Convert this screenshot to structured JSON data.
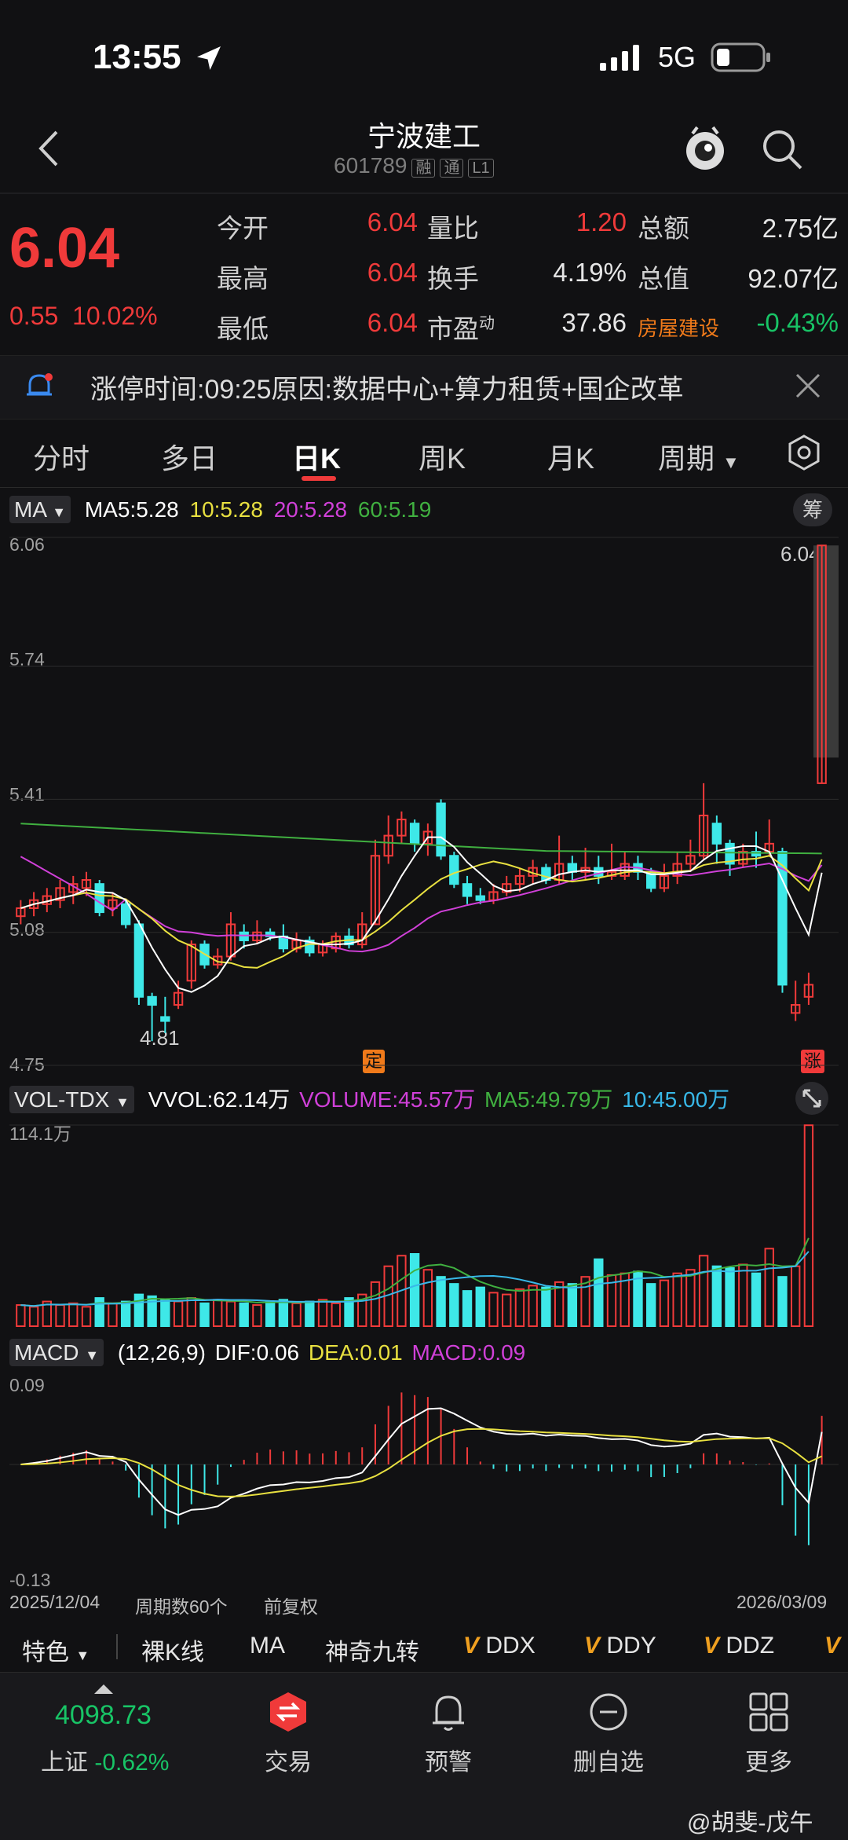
{
  "status": {
    "time": "13:55",
    "network": "5G"
  },
  "header": {
    "title": "宁波建工",
    "code": "601789",
    "tags": [
      "融",
      "通",
      "L1"
    ]
  },
  "quote": {
    "price": "6.04",
    "change": "0.55",
    "change_pct": "10.02%",
    "fields": [
      {
        "label": "今开",
        "value": "6.04"
      },
      {
        "label": "最高",
        "value": "6.04"
      },
      {
        "label": "最低",
        "value": "6.04"
      },
      {
        "label": "量比",
        "value": "1.20"
      },
      {
        "label": "换手",
        "value": "4.19%"
      },
      {
        "label": "市盈",
        "sup": "动",
        "value": "37.86"
      },
      {
        "label": "总额",
        "value": "2.75亿"
      },
      {
        "label": "总值",
        "value": "92.07亿"
      },
      {
        "label": "房屋建设",
        "value": "-0.43%"
      }
    ]
  },
  "notice": {
    "text": "涨停时间:09:25原因:数据中心+算力租赁+国企改革"
  },
  "tabs": [
    "分时",
    "多日",
    "日K",
    "周K",
    "月K",
    "周期"
  ],
  "ma_header": {
    "label": "MA",
    "ma5": "MA5:5.28",
    "ma10": "10:5.28",
    "ma20": "20:5.28",
    "ma60": "60:5.19",
    "chip": "筹"
  },
  "vol_header": {
    "label": "VOL-TDX",
    "vvol": "VVOL:62.14万",
    "volume": "VOLUME:45.57万",
    "ma5": "MA5:49.79万",
    "ma10": "10:45.00万"
  },
  "macd_header": {
    "label": "MACD",
    "params": "(12,26,9)",
    "dif": "DIF:0.06",
    "dea": "DEA:0.01",
    "macd": "MACD:0.09"
  },
  "price_axis": {
    "top": "6.06",
    "l2": "5.74",
    "l3": "5.41",
    "l4": "5.08",
    "bottom": "4.75",
    "last": "6.04",
    "low_mark": "4.81",
    "mark_ding": "定",
    "mark_zhang": "涨"
  },
  "vol_axis": {
    "top": "114.1万"
  },
  "macd_axis": {
    "top": "0.09",
    "bottom": "-0.13"
  },
  "x_axis": {
    "start": "2025/12/04",
    "count": "周期数60个",
    "adjust": "前复权",
    "end": "2026/03/09"
  },
  "toolbar": [
    "特色",
    "裸K线",
    "MA",
    "神奇九转",
    "DDX",
    "DDY",
    "DDZ"
  ],
  "bottom_nav": {
    "index_value": "4098.73",
    "index_name": "上证",
    "index_change": "-0.62%",
    "items": [
      "交易",
      "预警",
      "删自选",
      "更多"
    ]
  },
  "watermark": "@胡斐-戊午",
  "colors": {
    "up": "#f03a3a",
    "down": "#3ee8e8",
    "ma5": "#ffffff",
    "ma10": "#e8e040",
    "ma20": "#d040d8",
    "ma60": "#40b040"
  },
  "chart_data": {
    "type": "candlestick",
    "candles": [
      {
        "o": 5.12,
        "c": 5.14,
        "h": 5.16,
        "l": 5.1
      },
      {
        "o": 5.14,
        "c": 5.16,
        "h": 5.18,
        "l": 5.12
      },
      {
        "o": 5.15,
        "c": 5.17,
        "h": 5.19,
        "l": 5.13
      },
      {
        "o": 5.16,
        "c": 5.19,
        "h": 5.21,
        "l": 5.14
      },
      {
        "o": 5.18,
        "c": 5.2,
        "h": 5.22,
        "l": 5.15
      },
      {
        "o": 5.19,
        "c": 5.21,
        "h": 5.23,
        "l": 5.17
      },
      {
        "o": 5.2,
        "c": 5.13,
        "h": 5.21,
        "l": 5.12
      },
      {
        "o": 5.14,
        "c": 5.16,
        "h": 5.18,
        "l": 5.12
      },
      {
        "o": 5.15,
        "c": 5.1,
        "h": 5.16,
        "l": 5.09
      },
      {
        "o": 5.1,
        "c": 4.92,
        "h": 5.11,
        "l": 4.9
      },
      {
        "o": 4.92,
        "c": 4.9,
        "h": 4.93,
        "l": 4.81
      },
      {
        "o": 4.87,
        "c": 4.86,
        "h": 4.92,
        "l": 4.83
      },
      {
        "o": 4.9,
        "c": 4.93,
        "h": 4.96,
        "l": 4.89
      },
      {
        "o": 4.96,
        "c": 5.05,
        "h": 5.06,
        "l": 4.94
      },
      {
        "o": 5.05,
        "c": 5.0,
        "h": 5.06,
        "l": 4.99
      },
      {
        "o": 5.0,
        "c": 5.02,
        "h": 5.04,
        "l": 4.99
      },
      {
        "o": 5.02,
        "c": 5.1,
        "h": 5.13,
        "l": 5.01
      },
      {
        "o": 5.08,
        "c": 5.06,
        "h": 5.1,
        "l": 5.04
      },
      {
        "o": 5.06,
        "c": 5.08,
        "h": 5.11,
        "l": 5.05
      },
      {
        "o": 5.08,
        "c": 5.07,
        "h": 5.09,
        "l": 5.06
      },
      {
        "o": 5.07,
        "c": 5.04,
        "h": 5.1,
        "l": 5.03
      },
      {
        "o": 5.04,
        "c": 5.06,
        "h": 5.08,
        "l": 5.03
      },
      {
        "o": 5.06,
        "c": 5.03,
        "h": 5.07,
        "l": 5.02
      },
      {
        "o": 5.03,
        "c": 5.05,
        "h": 5.06,
        "l": 5.02
      },
      {
        "o": 5.04,
        "c": 5.07,
        "h": 5.08,
        "l": 5.03
      },
      {
        "o": 5.07,
        "c": 5.05,
        "h": 5.09,
        "l": 5.04
      },
      {
        "o": 5.05,
        "c": 5.1,
        "h": 5.13,
        "l": 5.04
      },
      {
        "o": 5.1,
        "c": 5.27,
        "h": 5.31,
        "l": 5.1
      },
      {
        "o": 5.27,
        "c": 5.32,
        "h": 5.37,
        "l": 5.25
      },
      {
        "o": 5.32,
        "c": 5.36,
        "h": 5.38,
        "l": 5.3
      },
      {
        "o": 5.35,
        "c": 5.3,
        "h": 5.36,
        "l": 5.28
      },
      {
        "o": 5.3,
        "c": 5.33,
        "h": 5.35,
        "l": 5.27
      },
      {
        "o": 5.4,
        "c": 5.27,
        "h": 5.41,
        "l": 5.26
      },
      {
        "o": 5.27,
        "c": 5.2,
        "h": 5.28,
        "l": 5.19
      },
      {
        "o": 5.2,
        "c": 5.17,
        "h": 5.22,
        "l": 5.15
      },
      {
        "o": 5.17,
        "c": 5.16,
        "h": 5.19,
        "l": 5.15
      },
      {
        "o": 5.16,
        "c": 5.18,
        "h": 5.2,
        "l": 5.15
      },
      {
        "o": 5.18,
        "c": 5.2,
        "h": 5.22,
        "l": 5.17
      },
      {
        "o": 5.2,
        "c": 5.22,
        "h": 5.24,
        "l": 5.18
      },
      {
        "o": 5.22,
        "c": 5.24,
        "h": 5.26,
        "l": 5.2
      },
      {
        "o": 5.24,
        "c": 5.21,
        "h": 5.25,
        "l": 5.2
      },
      {
        "o": 5.21,
        "c": 5.25,
        "h": 5.32,
        "l": 5.2
      },
      {
        "o": 5.25,
        "c": 5.23,
        "h": 5.27,
        "l": 5.21
      },
      {
        "o": 5.23,
        "c": 5.24,
        "h": 5.29,
        "l": 5.21
      },
      {
        "o": 5.24,
        "c": 5.22,
        "h": 5.27,
        "l": 5.2
      },
      {
        "o": 5.22,
        "c": 5.23,
        "h": 5.3,
        "l": 5.21
      },
      {
        "o": 5.22,
        "c": 5.25,
        "h": 5.28,
        "l": 5.21
      },
      {
        "o": 5.25,
        "c": 5.23,
        "h": 5.27,
        "l": 5.21
      },
      {
        "o": 5.23,
        "c": 5.19,
        "h": 5.24,
        "l": 5.18
      },
      {
        "o": 5.19,
        "c": 5.22,
        "h": 5.25,
        "l": 5.18
      },
      {
        "o": 5.22,
        "c": 5.25,
        "h": 5.28,
        "l": 5.2
      },
      {
        "o": 5.25,
        "c": 5.27,
        "h": 5.31,
        "l": 5.23
      },
      {
        "o": 5.27,
        "c": 5.37,
        "h": 5.45,
        "l": 5.26
      },
      {
        "o": 5.35,
        "c": 5.3,
        "h": 5.37,
        "l": 5.25
      },
      {
        "o": 5.3,
        "c": 5.25,
        "h": 5.31,
        "l": 5.22
      },
      {
        "o": 5.25,
        "c": 5.28,
        "h": 5.3,
        "l": 5.24
      },
      {
        "o": 5.28,
        "c": 5.27,
        "h": 5.33,
        "l": 5.24
      },
      {
        "o": 5.28,
        "c": 5.3,
        "h": 5.36,
        "l": 5.27
      },
      {
        "o": 5.28,
        "c": 4.95,
        "h": 5.29,
        "l": 4.93
      },
      {
        "o": 4.88,
        "c": 4.9,
        "h": 4.96,
        "l": 4.86
      },
      {
        "o": 4.92,
        "c": 4.95,
        "h": 4.98,
        "l": 4.9
      },
      {
        "o": 5.45,
        "c": 6.04,
        "h": 6.04,
        "l": 5.45
      }
    ],
    "ylim": [
      4.75,
      6.06
    ],
    "volume": [
      12,
      11,
      14,
      12,
      13,
      11,
      16,
      13,
      14,
      18,
      17,
      15,
      14,
      16,
      13,
      15,
      14,
      13,
      12,
      14,
      15,
      13,
      14,
      15,
      13,
      16,
      18,
      25,
      34,
      40,
      41,
      32,
      28,
      24,
      20,
      22,
      19,
      18,
      21,
      23,
      22,
      25,
      24,
      28,
      38,
      29,
      30,
      31,
      24,
      26,
      30,
      32,
      40,
      34,
      33,
      35,
      30,
      44,
      28,
      34,
      114
    ],
    "volume_ylim": [
      0,
      114.1
    ],
    "macd_ylim": [
      -0.13,
      0.09
    ]
  }
}
